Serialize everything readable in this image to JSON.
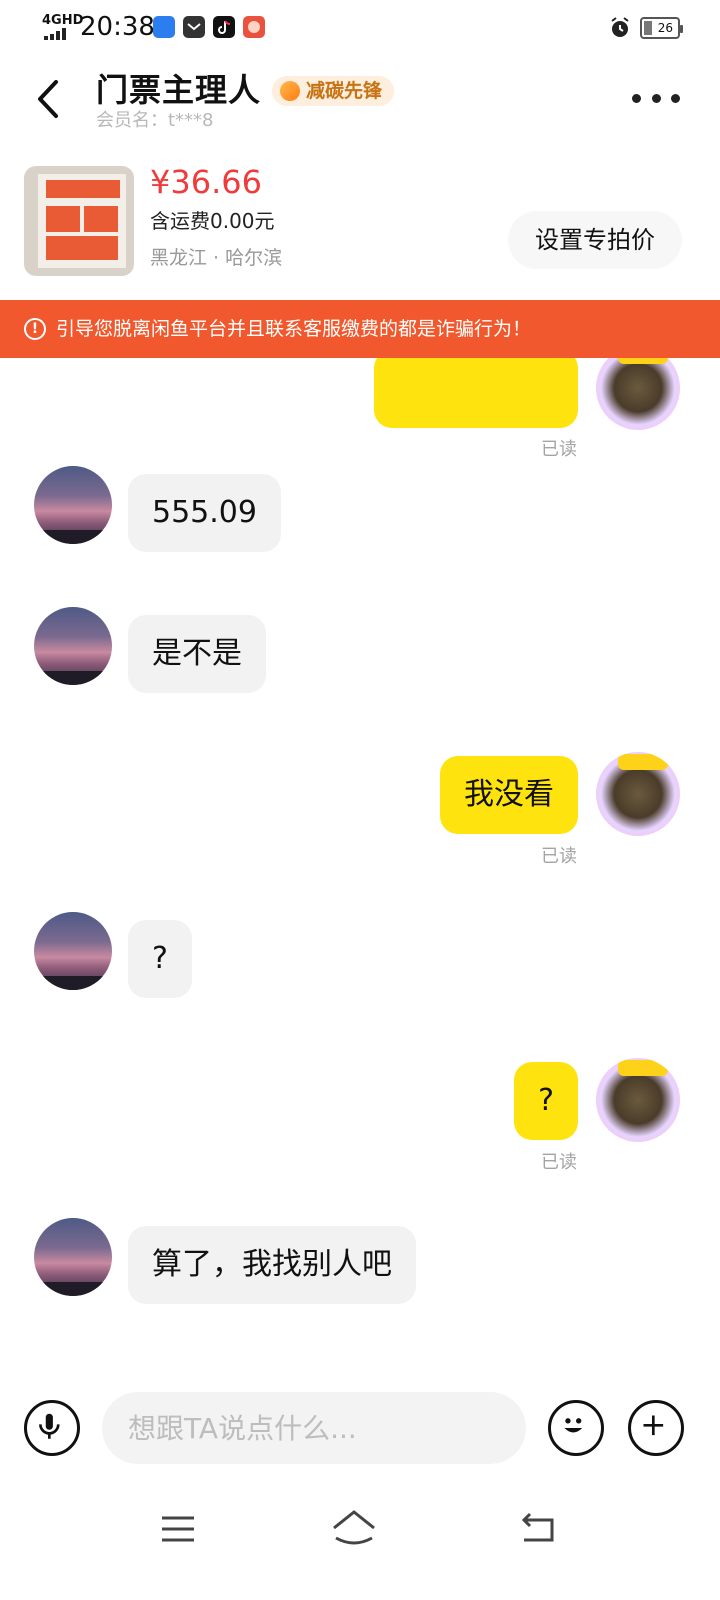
{
  "status_bar": {
    "network": "4GHD",
    "time": "20:38",
    "battery": "26",
    "icons": [
      "wifi-signal-icon",
      "taobao-live-icon",
      "mail-icon",
      "tiktok-icon",
      "pinduoduo-icon",
      "alarm-icon",
      "battery-icon"
    ]
  },
  "header": {
    "title": "门票主理人",
    "badge": "减碳先锋",
    "member_label": "会员名：t***8",
    "back_icon": "chevron-left-icon",
    "more_icon": "more-dots-icon"
  },
  "item": {
    "price": "¥36.66",
    "shipping": "含运费0.00元",
    "location": "黑龙江 · 哈尔滨",
    "special_price_button": "设置专拍价"
  },
  "warning": {
    "icon": "alert-circle-icon",
    "text": "引导您脱离闲鱼平台并且联系客服缴费的都是诈骗行为！"
  },
  "chat": {
    "messages": [
      {
        "side": "right",
        "text": "",
        "read": "已读"
      },
      {
        "side": "left",
        "text": "555.09"
      },
      {
        "side": "left",
        "text": "是不是"
      },
      {
        "side": "right",
        "text": "我没看",
        "read": "已读"
      },
      {
        "side": "left",
        "text": "?"
      },
      {
        "side": "right",
        "text": "?",
        "read": "已读"
      },
      {
        "side": "left",
        "text": "算了，我找别人吧"
      }
    ]
  },
  "input_bar": {
    "placeholder": "想跟TA说点什么...",
    "icons": [
      "microphone-icon",
      "emoji-icon",
      "plus-icon"
    ]
  },
  "nav_bar": {
    "icons": [
      "menu-icon",
      "home-icon",
      "back-icon"
    ]
  },
  "colors": {
    "accent_yellow": "#ffe30e",
    "warning_orange": "#f1582d",
    "price_red": "#ef3b3b",
    "badge_text": "#c77313"
  }
}
